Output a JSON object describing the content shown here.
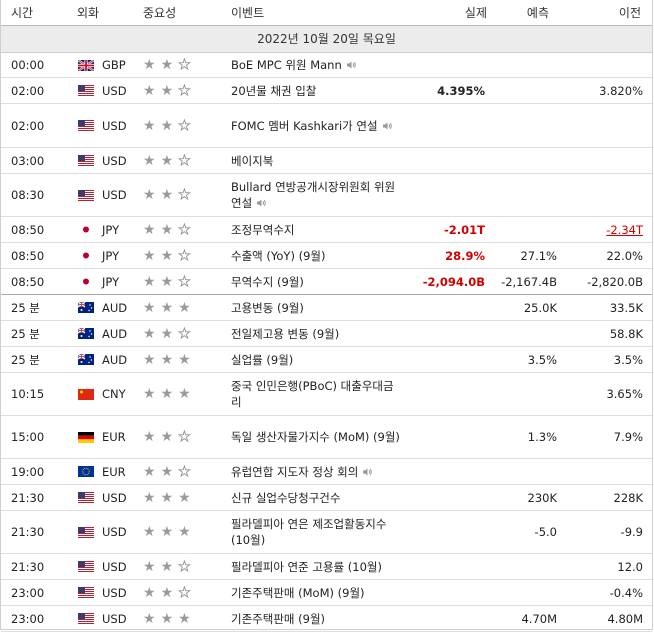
{
  "headers": {
    "time": "시간",
    "currency": "외화",
    "importance": "중요성",
    "event": "이벤트",
    "actual": "실제",
    "forecast": "예측",
    "previous": "이전"
  },
  "date": "2022년 10월 20일 목요일",
  "colors": {
    "red": "#d40000",
    "grey_star": "#9a9a9a",
    "header_border": "#b8b8b8",
    "date_bg": "#ececec"
  },
  "rows": [
    {
      "time": "00:00",
      "cur": "GBP",
      "flag": "gb",
      "stars": 2,
      "event": "BoE MPC 위원 Mann",
      "speaker": true,
      "actual": "",
      "forecast": "",
      "previous": "",
      "h": 25
    },
    {
      "time": "02:00",
      "cur": "USD",
      "flag": "us",
      "stars": 2,
      "event": "20년물 채권 입찰",
      "actual": "4.395%",
      "actual_color": "dark",
      "forecast": "",
      "previous": "3.820%",
      "h": 26
    },
    {
      "time": "02:00",
      "cur": "USD",
      "flag": "us",
      "stars": 2,
      "event": "FOMC 멤버 Kashkari가 연설",
      "speaker": true,
      "actual": "",
      "forecast": "",
      "previous": "",
      "h": 44
    },
    {
      "time": "03:00",
      "cur": "USD",
      "flag": "us",
      "stars": 2,
      "event": "베이지북",
      "actual": "",
      "forecast": "",
      "previous": "",
      "h": 26
    },
    {
      "time": "08:30",
      "cur": "USD",
      "flag": "us",
      "stars": 2,
      "event": "Bullard 연방공개시장위원회 위원 연설",
      "speaker": true,
      "actual": "",
      "forecast": "",
      "previous": "",
      "h": 43
    },
    {
      "time": "08:50",
      "cur": "JPY",
      "flag": "jp",
      "stars": 2,
      "event": "조정무역수지",
      "actual": "-2.01T",
      "actual_color": "red",
      "forecast": "",
      "previous": "-2.34T",
      "prev_style": "neg",
      "h": 26
    },
    {
      "time": "08:50",
      "cur": "JPY",
      "flag": "jp",
      "stars": 2,
      "event": "수출액 (YoY) (9월)",
      "actual": "28.9%",
      "actual_color": "red",
      "forecast": "27.1%",
      "previous": "22.0%",
      "h": 26
    },
    {
      "time": "08:50",
      "cur": "JPY",
      "flag": "jp",
      "stars": 2,
      "event": "무역수지 (9월)",
      "actual": "-2,094.0B",
      "actual_color": "red",
      "forecast": "-2,167.4B",
      "previous": "-2,820.0B",
      "h": 26,
      "grp": true
    },
    {
      "time": "25 분",
      "cur": "AUD",
      "flag": "au",
      "stars": 3,
      "event": "고용변동 (9월)",
      "actual": "",
      "forecast": "25.0K",
      "previous": "33.5K",
      "h": 26
    },
    {
      "time": "25 분",
      "cur": "AUD",
      "flag": "au",
      "stars": 2,
      "event": "전일제고용 변동 (9월)",
      "actual": "",
      "forecast": "",
      "previous": "58.8K",
      "h": 26
    },
    {
      "time": "25 분",
      "cur": "AUD",
      "flag": "au",
      "stars": 3,
      "event": "실업률 (9월)",
      "actual": "",
      "forecast": "3.5%",
      "previous": "3.5%",
      "h": 26
    },
    {
      "time": "10:15",
      "cur": "CNY",
      "flag": "cn",
      "stars": 3,
      "event": "중국 인민은행(PBoC) 대출우대금리",
      "actual": "",
      "forecast": "",
      "previous": "3.65%",
      "h": 43
    },
    {
      "time": "15:00",
      "cur": "EUR",
      "flag": "de",
      "stars": 2,
      "event": "독일 생산자물가지수 (MoM) (9월)",
      "actual": "",
      "forecast": "1.3%",
      "previous": "7.9%",
      "h": 43
    },
    {
      "time": "19:00",
      "cur": "EUR",
      "flag": "eu",
      "stars": 2,
      "event": "유럽연합 지도자 정상 회의",
      "speaker": true,
      "actual": "",
      "forecast": "",
      "previous": "",
      "h": 26
    },
    {
      "time": "21:30",
      "cur": "USD",
      "flag": "us",
      "stars": 3,
      "event": "신규 실업수당청구건수",
      "actual": "",
      "forecast": "230K",
      "previous": "228K",
      "h": 26
    },
    {
      "time": "21:30",
      "cur": "USD",
      "flag": "us",
      "stars": 3,
      "event": "필라델피아 연은 제조업활동지수 (10월)",
      "actual": "",
      "forecast": "-5.0",
      "previous": "-9.9",
      "h": 43
    },
    {
      "time": "21:30",
      "cur": "USD",
      "flag": "us",
      "stars": 2,
      "event": "필라델피아 연준 고용률 (10월)",
      "actual": "",
      "forecast": "",
      "previous": "12.0",
      "h": 26
    },
    {
      "time": "23:00",
      "cur": "USD",
      "flag": "us",
      "stars": 2,
      "event": "기존주택판매 (MoM) (9월)",
      "actual": "",
      "forecast": "",
      "previous": "-0.4%",
      "h": 26
    },
    {
      "time": "23:00",
      "cur": "USD",
      "flag": "us",
      "stars": 3,
      "event": "기존주택판매 (9월)",
      "actual": "",
      "forecast": "4.70M",
      "previous": "4.80M",
      "h": 26
    }
  ]
}
